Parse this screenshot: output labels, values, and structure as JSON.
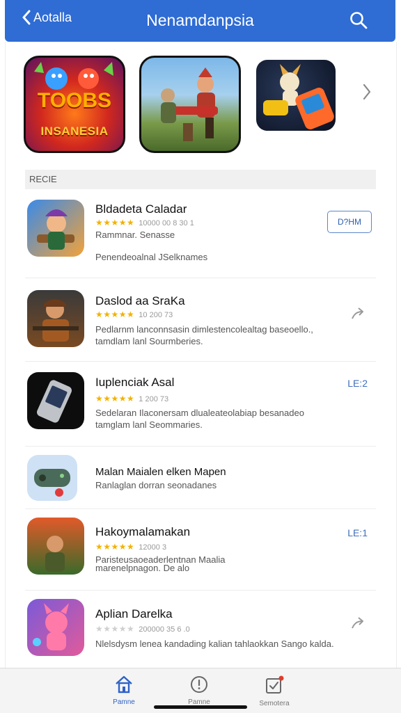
{
  "header": {
    "back_label": "Aotalla",
    "title": "Nenamdanpsia",
    "colors": {
      "bar": "#2f6cd4",
      "text": "#ffffff"
    }
  },
  "featured": [
    {
      "line1": "TOOBS",
      "line2": "INSANESIA",
      "icon": "toons-game-art"
    },
    {
      "line1": "",
      "line2": "",
      "icon": "shooter-game-art"
    },
    {
      "line1": "",
      "line2": "",
      "icon": "handheld-game-art"
    }
  ],
  "section_header": "RECIE",
  "apps": [
    {
      "name": "Bldadeta Caladar",
      "rating_meta": "10000 00 8 30 1",
      "desc": "Rammnar. Senasse",
      "desc2": "Penendeoalnal JSelknames",
      "action": "D?HM",
      "action_type": "button"
    },
    {
      "name": "Daslod aa SraKa",
      "rating_meta": "10 200 73",
      "desc": "Pedlarnm lanconnsasin dimlestencolealtag baseoello.,",
      "desc2": "tamdlam lanl Sourmberies.",
      "action": "",
      "action_type": "share"
    },
    {
      "name": "Iuplenciak Asal",
      "rating_meta": "1 200 73",
      "desc": "Sedelaran Ilaconersam dlualeateolabiap besanadeo",
      "desc2": "tamglam lanl Seommaries.",
      "action": "LE:2",
      "action_type": "badge"
    },
    {
      "name": "Malan Maialen elken Mapen",
      "rating_meta": "",
      "desc": "Ranlaglan dorran seonadanes",
      "desc2": "",
      "action": "",
      "action_type": "none"
    },
    {
      "name": "Hakoymalamakan",
      "rating_meta": "12000 3",
      "desc": "Paristeusaoeaderlentnan Maalia",
      "desc2": "marenelpnagon. De alo",
      "action": "LE:1",
      "action_type": "badge"
    },
    {
      "name": "Aplian Darelka",
      "rating_meta": "200000 35 6 .0",
      "desc": "Nlelsdysm lenea kandading kalian tahlaokkan Sango kalda.",
      "desc2": "",
      "action": "",
      "action_type": "share"
    }
  ],
  "tabs": [
    {
      "label": "Pamne",
      "icon": "home-icon",
      "active": true
    },
    {
      "label": "Pamne",
      "icon": "info-icon",
      "active": false
    },
    {
      "label": "Semotera",
      "icon": "checklist-icon",
      "active": false
    }
  ]
}
